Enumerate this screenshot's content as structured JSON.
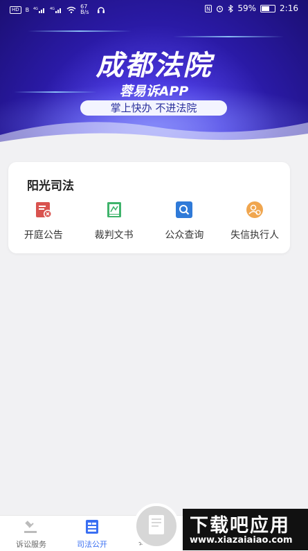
{
  "status_bar": {
    "left_indicators": [
      "HD",
      "B",
      "4G",
      "4G",
      "wifi",
      "67 B/s"
    ],
    "battery": "59%",
    "time": "2:16"
  },
  "banner": {
    "title": "成都法院",
    "subtitle": "蓉易诉APP",
    "slogan": "掌上快办  不进法院"
  },
  "sunlight_card": {
    "title": "阳光司法",
    "items": [
      {
        "label": "开庭公告",
        "icon": "court-notice-icon",
        "color": "#d9534f"
      },
      {
        "label": "裁判文书",
        "icon": "judgment-document-icon",
        "color": "#3fb36b"
      },
      {
        "label": "公众查询",
        "icon": "search-icon",
        "color": "#2f7ad8"
      },
      {
        "label": "失信执行人",
        "icon": "dishonest-person-icon",
        "color": "#f0a64f"
      }
    ]
  },
  "bottom_nav": {
    "items": [
      {
        "label": "诉讼服务",
        "icon": "gavel-icon",
        "active": false
      },
      {
        "label": "司法公开",
        "icon": "public-info-icon",
        "active": true
      },
      {
        "label": "我的案件",
        "icon": "my-cases-icon",
        "active": false
      }
    ]
  },
  "watermark": {
    "title": "下载吧应用",
    "url": "www.xiazaiaiao.com"
  },
  "colors": {
    "accent": "#3a6ff2",
    "banner": "#3a2bd0"
  }
}
